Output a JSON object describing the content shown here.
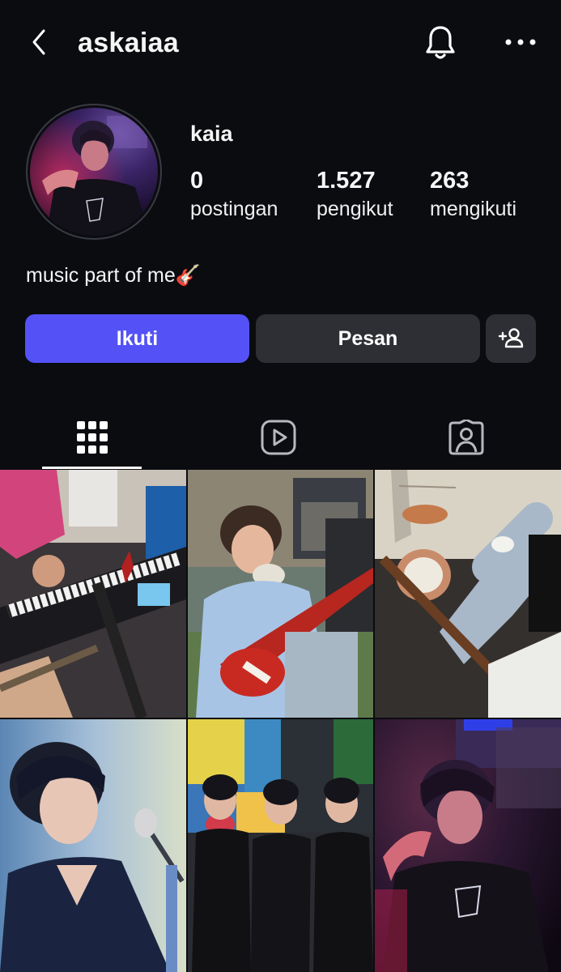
{
  "header": {
    "username": "askaiaa",
    "back_icon": "chevron-left-icon",
    "bell_icon": "bell-icon",
    "more_icon": "more-horizontal-icon"
  },
  "profile": {
    "display_name": "kaia",
    "stats": [
      {
        "value": "0",
        "label": "postingan"
      },
      {
        "value": "1.527",
        "label": "pengikut"
      },
      {
        "value": "263",
        "label": "mengikuti"
      }
    ],
    "bio": "music part of me🎸"
  },
  "actions": {
    "follow_label": "Ikuti",
    "message_label": "Pesan",
    "suggest_icon": "add-person-icon",
    "follow_color": "#5452f6"
  },
  "tabs": [
    {
      "icon": "grid-icon",
      "active": true
    },
    {
      "icon": "reels-icon",
      "active": false
    },
    {
      "icon": "tagged-person-icon",
      "active": false
    }
  ],
  "posts": [
    {
      "subject": "band practice with keyboard and guitars"
    },
    {
      "subject": "boy holding red electric guitar"
    },
    {
      "subject": "drum kit and bass guitar"
    },
    {
      "subject": "singer at microphone"
    },
    {
      "subject": "three boys in black shirts"
    },
    {
      "subject": "boy in neon-lit room"
    }
  ]
}
